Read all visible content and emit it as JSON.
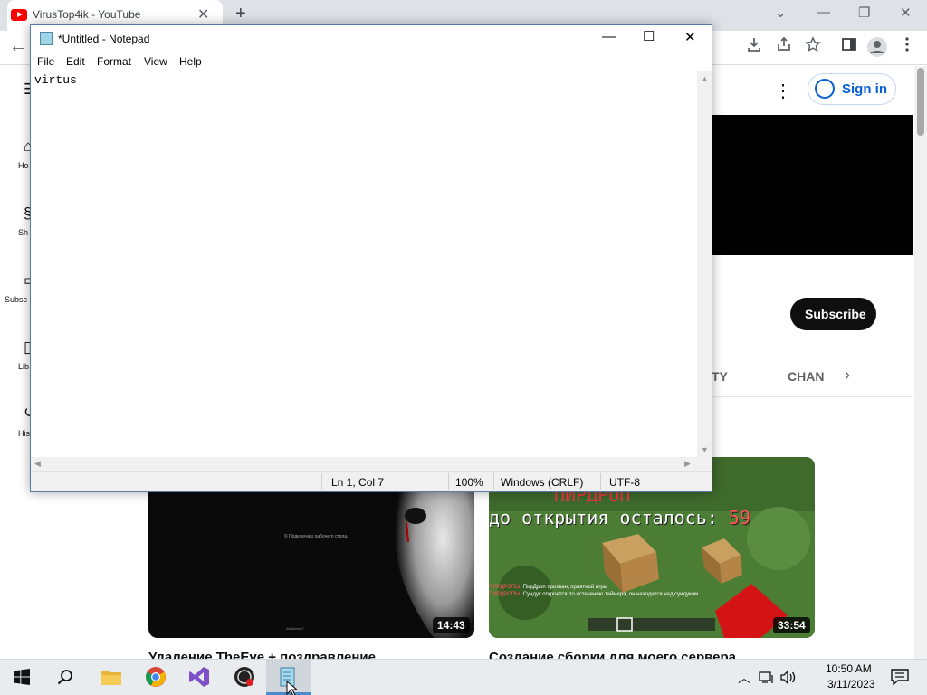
{
  "browser": {
    "tab_title": "VirusTop4ik - YouTube",
    "tab_close": "✕",
    "new_tab": "+",
    "window_controls": [
      "⌄",
      "—",
      "❐",
      "✕"
    ],
    "back": "←",
    "toolbar_icons": [
      "download-icon",
      "share-icon",
      "star-icon",
      "side-panel-icon",
      "profile-icon",
      "more-icon"
    ]
  },
  "youtube": {
    "sidebar": [
      {
        "label": "Ho",
        "icon": "home-icon"
      },
      {
        "label": "Sh",
        "icon": "shorts-icon"
      },
      {
        "label": "Subsc",
        "icon": "subscriptions-icon"
      },
      {
        "label": "Lib",
        "icon": "library-icon"
      },
      {
        "label": "His",
        "icon": "history-icon"
      }
    ],
    "sign_in": "Sign in",
    "subscribe": "Subscribe",
    "channel_tabs": [
      "TY",
      "CHAN"
    ],
    "videos": [
      {
        "title": "Удаление TheEye + поздравление",
        "duration": "14:43",
        "thumb_text": "© Подключаю рабочего стола..",
        "thumb_text2": "Windows 7"
      },
      {
        "title": "Создание сборки для моего сервера",
        "duration": "33:54",
        "thumb_top": "ПИРДРОП",
        "thumb_line": "до открытия осталось:",
        "thumb_num": "59",
        "thumb_overlay": [
          {
            "tag": "ПИРДРОПЫ:",
            "text": "ПирДроп призван, приятной игры"
          },
          {
            "tag": "ПИРДРОПЫ:",
            "text": "Сундук откроется по истечению таймера, он находится над сундуком"
          }
        ]
      }
    ]
  },
  "notepad": {
    "title": "*Untitled - Notepad",
    "controls": [
      "—",
      "☐",
      "✕"
    ],
    "menu": [
      "File",
      "Edit",
      "Format",
      "View",
      "Help"
    ],
    "content": "virtus",
    "status": {
      "position": "Ln 1, Col 7",
      "zoom": "100%",
      "line_ending": "Windows (CRLF)",
      "encoding": "UTF-8"
    }
  },
  "taskbar": {
    "apps": [
      "start-icon",
      "search-icon",
      "file-explorer-icon",
      "chrome-icon",
      "visual-studio-icon",
      "obs-icon",
      "notepad-icon"
    ],
    "time": "10:50 AM",
    "date": "3/11/2023"
  }
}
